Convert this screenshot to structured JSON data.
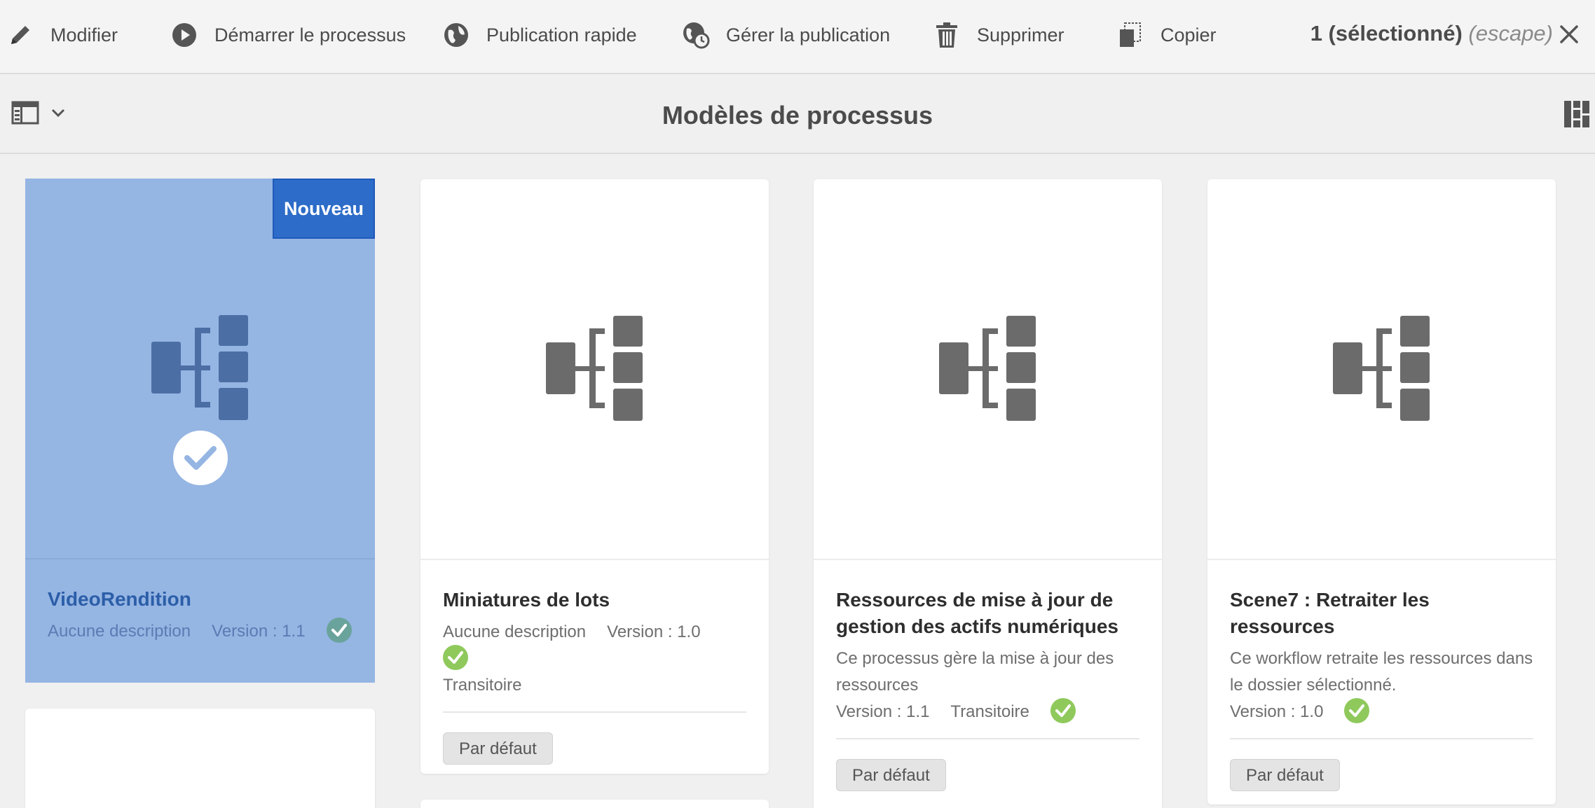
{
  "actionbar": {
    "actions": [
      {
        "label": "Modifier",
        "icon": "pencil-icon"
      },
      {
        "label": "Démarrer le processus",
        "icon": "play-circle-icon"
      },
      {
        "label": "Publication rapide",
        "icon": "globe-icon"
      },
      {
        "label": "Gérer la publication",
        "icon": "globe-clock-icon"
      },
      {
        "label": "Supprimer",
        "icon": "trash-icon"
      },
      {
        "label": "Copier",
        "icon": "copy-icon"
      }
    ],
    "selection": {
      "count_label": "1 (sélectionné)",
      "escape_label": "(escape)"
    },
    "close_icon": "close-icon"
  },
  "titlebar": {
    "title": "Modèles de processus",
    "rail_icon": "rail-toggle-icon",
    "view_icon": "card-view-icon"
  },
  "cards": [
    {
      "title": "VideoRendition",
      "badge": "Nouveau",
      "description": "Aucune description",
      "version": "Version : 1.1",
      "selected": true
    },
    {
      "title": "Miniatures de lots",
      "description": "Aucune description",
      "version": "Version : 1.0",
      "status": "Transitoire",
      "tag": "Par défaut"
    },
    {
      "title": "Ressources de mise à jour de gestion des actifs numériques",
      "description": "Ce processus gère la mise à jour des ressources",
      "version": "Version : 1.1",
      "status": "Transitoire",
      "tag": "Par défaut"
    },
    {
      "title": "Scene7 : Retraiter les ressources",
      "description": "Ce workflow retraite les ressources dans le dossier sélectionné.",
      "version": "Version : 1.0",
      "tag": "Par défaut"
    }
  ],
  "colors": {
    "selected_card": "#95b5e3",
    "badge_new": "#2d6cc8",
    "enabled_check": "#8fc95c",
    "icon_gray": "#6b6b6b"
  }
}
